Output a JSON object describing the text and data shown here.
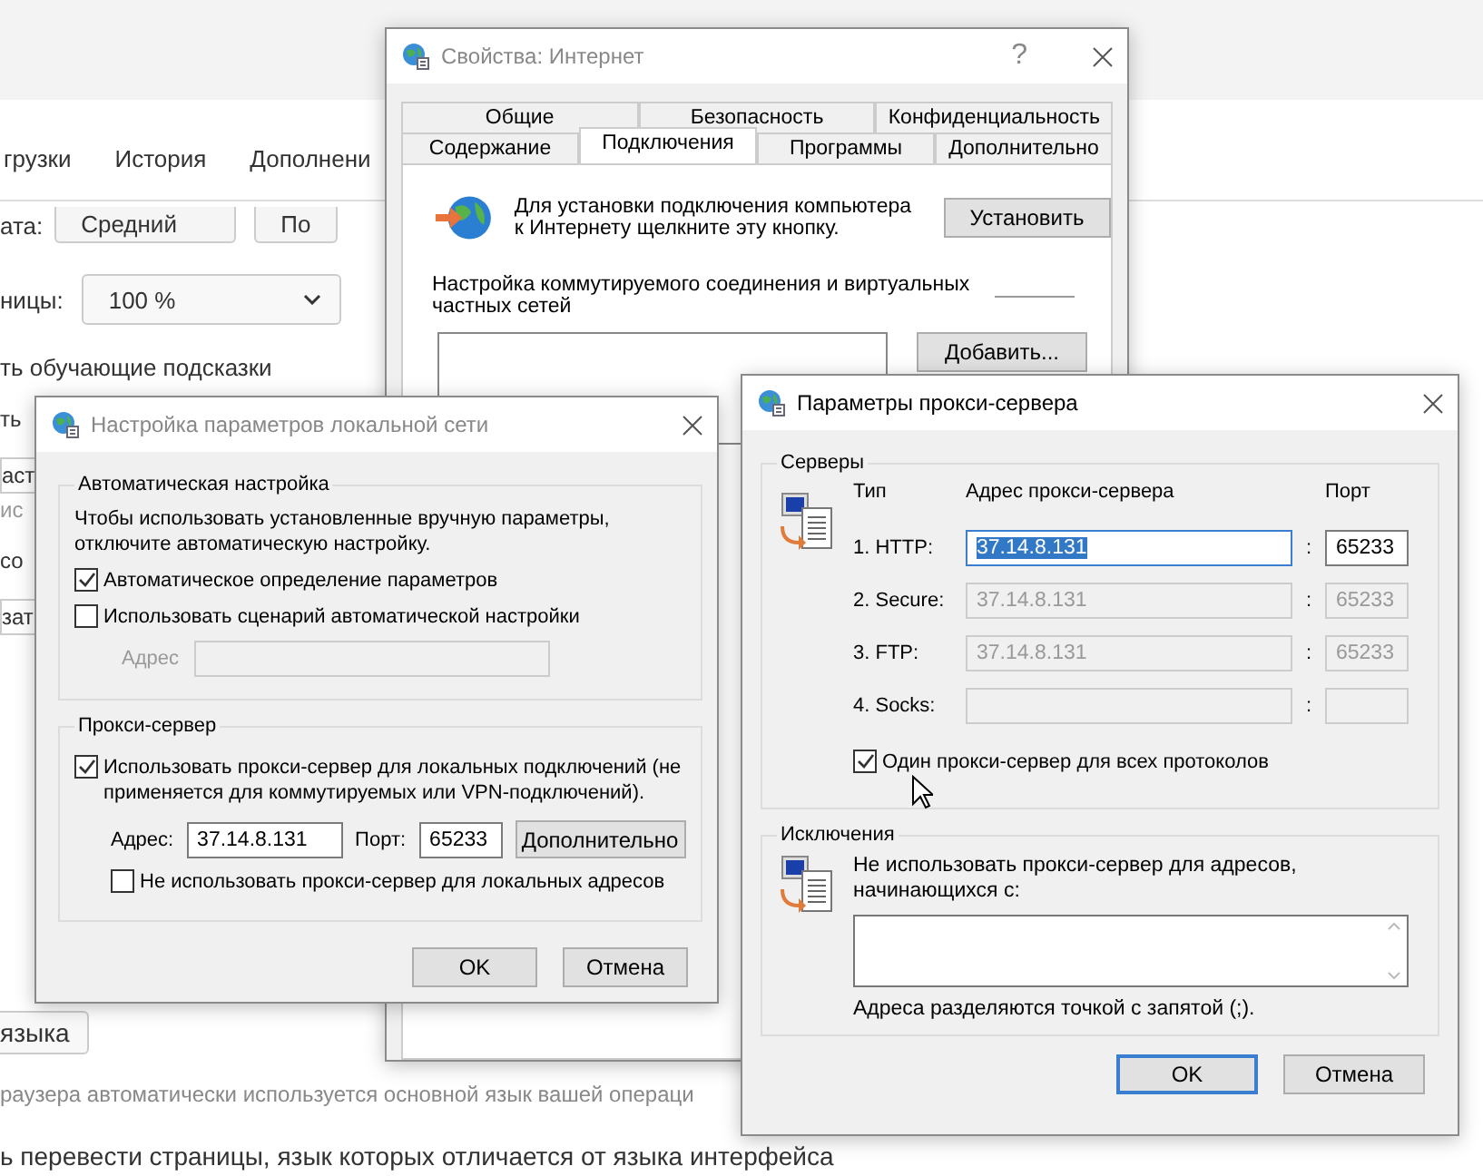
{
  "background_page": {
    "tabs": [
      {
        "label": "грузки"
      },
      {
        "label": "История"
      },
      {
        "label": "Дополнени"
      }
    ],
    "font_row": {
      "label": "ата:",
      "value": "Средний",
      "next_button": "По"
    },
    "zoom_row": {
      "label": "ницы:",
      "value": "100 %"
    },
    "hints_option": "ть обучающие подсказки",
    "fragments": [
      {
        "kind": "text",
        "text": "ть"
      },
      {
        "kind": "button",
        "text": "аст"
      },
      {
        "kind": "note",
        "text": "ис"
      },
      {
        "kind": "text",
        "text": "со"
      },
      {
        "kind": "button",
        "text": "зат"
      }
    ],
    "language_button": "языка",
    "language_note": "раузера автоматически используется основной язык вашей операци",
    "translate_option": "ь перевести страницы, язык которых отличается от языка интерфейса"
  },
  "internet_properties": {
    "title": "Свойства: Интернет",
    "help": "?",
    "tab_rows": [
      [
        {
          "label": "Общие",
          "selected": false
        },
        {
          "label": "Безопасность",
          "selected": false
        },
        {
          "label": "Конфиденциальность",
          "selected": false
        }
      ],
      [
        {
          "label": "Содержание",
          "selected": false
        },
        {
          "label": "Подключения",
          "selected": true
        },
        {
          "label": "Программы",
          "selected": false
        },
        {
          "label": "Дополнительно",
          "selected": false
        }
      ]
    ],
    "setup_text": "Для установки подключения компьютера к Интернету щелкните эту кнопку.",
    "setup_button": "Установить",
    "vpn_label": "Настройка коммутируемого соединения и виртуальных частных сетей",
    "add_button": "Добавить..."
  },
  "lan_settings": {
    "title": "Настройка параметров локальной сети",
    "auto_group": {
      "legend": "Автоматическая настройка",
      "note": "Чтобы использовать установленные вручную параметры, отключите автоматическую настройку.",
      "options": [
        {
          "label": "Автоматическое определение параметров",
          "checked": true
        },
        {
          "label": "Использовать сценарий автоматической настройки",
          "checked": false
        }
      ],
      "address_label": "Адрес",
      "address_disabled": true
    },
    "proxy_group": {
      "legend": "Прокси-сервер",
      "use_proxy": {
        "label": "Использовать прокси-сервер для локальных подключений (не применяется для коммутируемых или VPN-подключений).",
        "checked": true
      },
      "address_label": "Адрес:",
      "address": "37.14.8.131",
      "port_label": "Порт:",
      "port": "65233",
      "advanced_button": "Дополнительно",
      "bypass_local": {
        "label": "Не использовать прокси-сервер для локальных адресов",
        "checked": false
      }
    },
    "buttons": [
      {
        "label": "OK",
        "default": false
      },
      {
        "label": "Отмена",
        "default": false
      }
    ]
  },
  "proxy_settings": {
    "title": "Параметры прокси-сервера",
    "servers": {
      "legend": "Серверы",
      "headers": {
        "type": "Тип",
        "address": "Адрес прокси-сервера",
        "port": "Порт"
      },
      "rows": [
        {
          "label": "1. HTTP:",
          "address": "37.14.8.131",
          "port": "65233",
          "disabled": false,
          "selected": true
        },
        {
          "label": "2. Secure:",
          "address": "37.14.8.131",
          "port": "65233",
          "disabled": true,
          "selected": false
        },
        {
          "label": "3. FTP:",
          "address": "37.14.8.131",
          "port": "65233",
          "disabled": true,
          "selected": false
        },
        {
          "label": "4. Socks:",
          "disabled": true,
          "selected": false
        }
      ],
      "separator": ":",
      "same_for_all": {
        "label": "Один прокси-сервер для всех протоколов",
        "checked": true
      }
    },
    "exceptions": {
      "legend": "Исключения",
      "note": "Не использовать прокси-сервер для адресов, начинающихся с:",
      "hint": "Адреса разделяются точкой с запятой (;)."
    },
    "buttons": [
      {
        "label": "OK",
        "default": true
      },
      {
        "label": "Отмена",
        "default": false
      }
    ]
  }
}
